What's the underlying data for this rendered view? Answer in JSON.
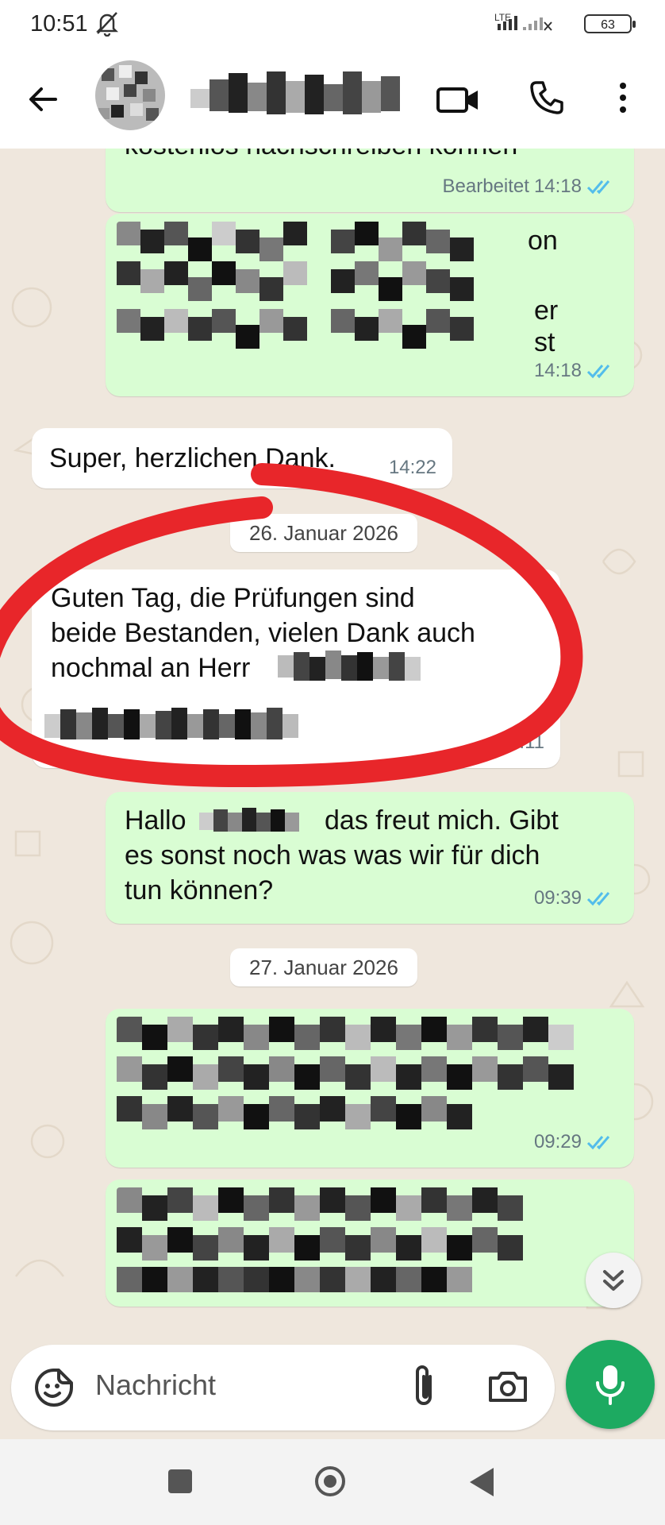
{
  "status_bar": {
    "time": "10:51",
    "network": "LTE",
    "battery": "63"
  },
  "header": {
    "contact_name": "",
    "icons": [
      "back-arrow-icon",
      "video-call-icon",
      "phone-icon",
      "more-vert-icon"
    ]
  },
  "messages": [
    {
      "direction": "outgoing",
      "text": "kostenlos nachschreiben können",
      "edited_label": "Bearbeitet",
      "time": "14:18",
      "read": true
    },
    {
      "direction": "outgoing",
      "text_visible_fragments": [
        "on",
        "er",
        "st"
      ],
      "time": "14:18",
      "read": true
    },
    {
      "direction": "incoming",
      "text": "Super, herzlichen Dank.",
      "time": "14:22"
    },
    {
      "type": "date",
      "text": "26. Januar 2026"
    },
    {
      "direction": "incoming",
      "text_line1": "Guten Tag, die Prüfungen sind",
      "text_line2": "beide Bestanden, vielen Dank auch",
      "text_line3": "nochmal an Herr",
      "time": "09:11",
      "highlighted": true
    },
    {
      "direction": "outgoing",
      "text_part1": "Hallo",
      "text_part2": "das freut mich. Gibt",
      "text_line2": "es sonst noch was was wir für dich",
      "text_line3": "tun können?",
      "time": "09:39",
      "read": true
    },
    {
      "type": "date",
      "text": "27. Januar 2026"
    },
    {
      "direction": "outgoing",
      "text": "",
      "time": "09:29",
      "read": true
    },
    {
      "direction": "outgoing",
      "text": ""
    }
  ],
  "composer": {
    "placeholder": "Nachricht",
    "icons": [
      "emoji-sticker-icon",
      "attach-icon",
      "camera-icon",
      "mic-icon"
    ]
  },
  "colors": {
    "outgoing_bubble": "#d9fdd3",
    "incoming_bubble": "#ffffff",
    "chat_background": "#efe7dd",
    "read_ticks": "#53bdeb",
    "mic_button": "#1daa61",
    "highlight_ring": "#e8262a"
  }
}
